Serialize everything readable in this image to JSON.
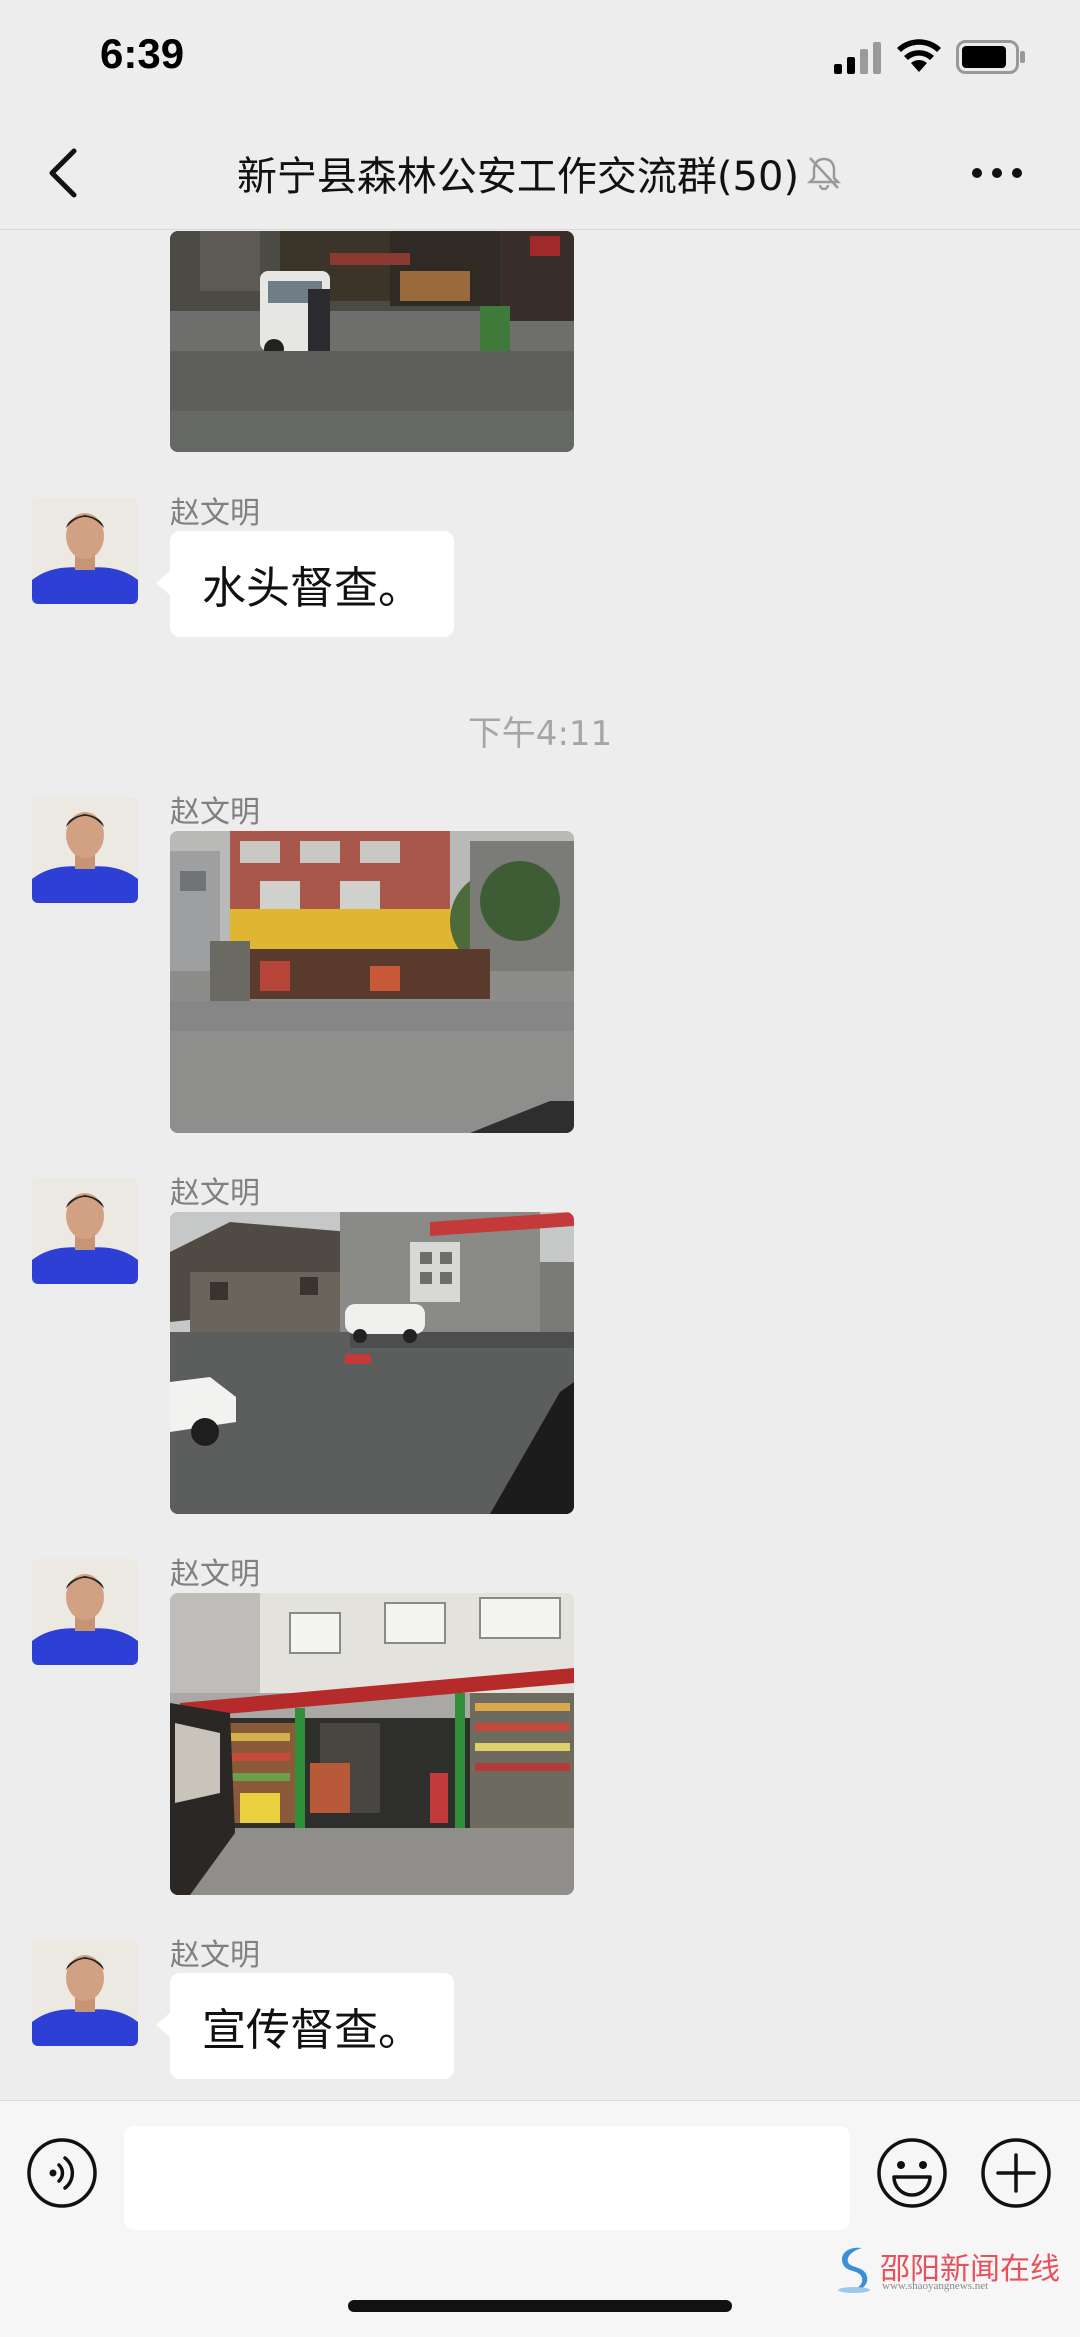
{
  "status_bar": {
    "time": "6:39"
  },
  "nav": {
    "title": "新宁县森林公安工作交流群(50)",
    "icons": [
      "back-icon",
      "mute-bell-icon",
      "more-icon"
    ]
  },
  "messages": [
    {
      "type": "image",
      "description_icon": "photo-street-rain"
    },
    {
      "type": "text",
      "sender": "赵文明",
      "text": "水头督查。"
    },
    {
      "type": "timestamp",
      "text": "下午4:11"
    },
    {
      "type": "image",
      "sender": "赵文明",
      "description_icon": "photo-storefront-yellow-sign"
    },
    {
      "type": "image",
      "sender": "赵文明",
      "description_icon": "photo-street-car"
    },
    {
      "type": "image",
      "sender": "赵文明",
      "description_icon": "photo-supermarket"
    },
    {
      "type": "text",
      "sender": "赵文明",
      "text": "宣传督查。"
    }
  ],
  "input_bar": {
    "placeholder": "",
    "icons": [
      "voice-icon",
      "emoji-icon",
      "plus-icon"
    ]
  },
  "watermark": {
    "text": "邵阳新闻在线",
    "url": "www.shaoyangnews.net"
  },
  "colors": {
    "background": "#EDEDED",
    "bubble": "#FFFFFF",
    "avatar_shirt": "#2E3FD6",
    "watermark": "#E8505B"
  }
}
